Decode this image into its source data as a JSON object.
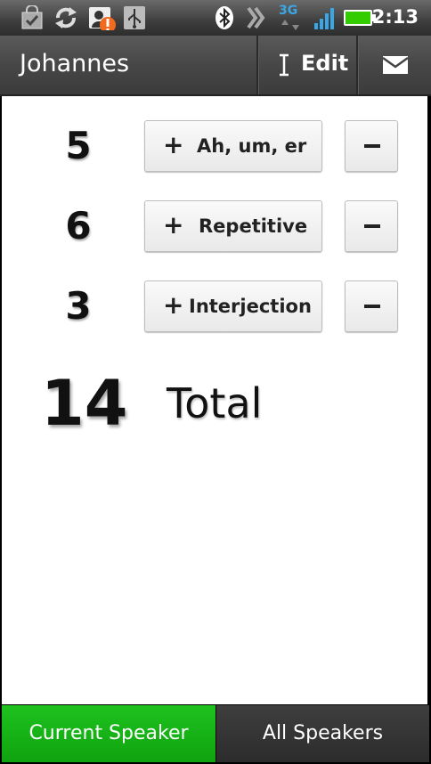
{
  "status_bar": {
    "time": "2:13",
    "network_label": "3G",
    "icons": [
      "market-icon",
      "sync-icon",
      "contact-alert-icon",
      "usb-icon",
      "bluetooth-icon",
      "vibrate-icon",
      "network-3g-icon",
      "signal-icon",
      "battery-icon"
    ],
    "battery_color": "#33cc00"
  },
  "action_bar": {
    "title": "Johannes",
    "edit_label": "Edit",
    "mail_icon": "mail-icon"
  },
  "counters": [
    {
      "count": "5",
      "label": "Ah, um, er"
    },
    {
      "count": "6",
      "label": "Repetitive"
    },
    {
      "count": "3",
      "label": "Interjection"
    }
  ],
  "total": {
    "count": "14",
    "label": "Total"
  },
  "tabs": [
    {
      "label": "Current Speaker",
      "selected": true,
      "color": "#12b012"
    },
    {
      "label": "All Speakers",
      "selected": false,
      "color": "#333333"
    }
  ]
}
